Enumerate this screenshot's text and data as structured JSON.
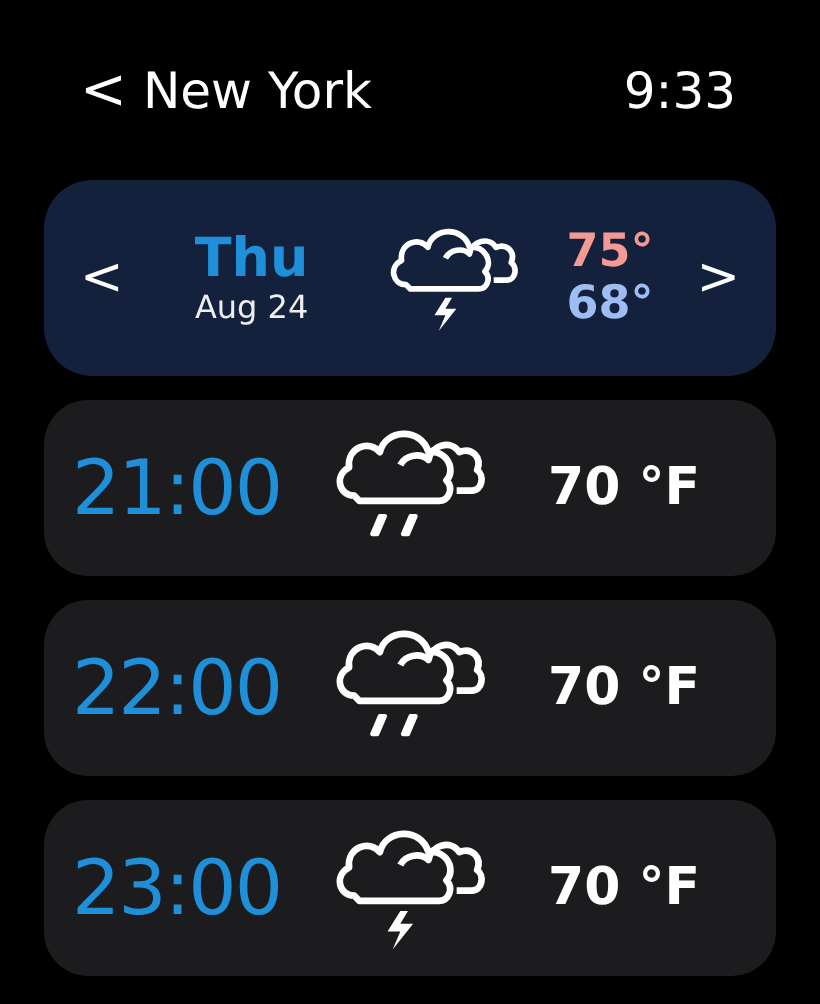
{
  "header": {
    "back": "<",
    "title": "New York",
    "time": "9:33"
  },
  "day": {
    "prev": "<",
    "next": ">",
    "weekday": "Thu",
    "date": "Aug 24",
    "kind": "thunder",
    "high": "75°",
    "low": "68°"
  },
  "hours": [
    {
      "time": "21:00",
      "kind": "rain",
      "temp": "70 °F"
    },
    {
      "time": "22:00",
      "kind": "rain",
      "temp": "70 °F"
    },
    {
      "time": "23:00",
      "kind": "thunder",
      "temp": "70 °F"
    }
  ]
}
